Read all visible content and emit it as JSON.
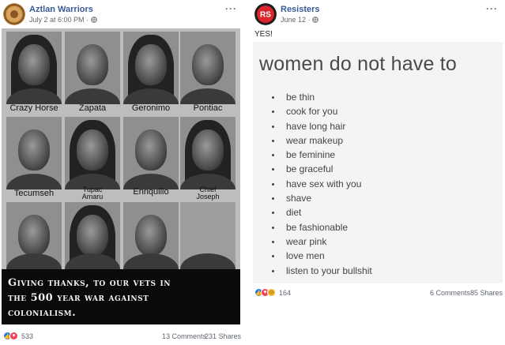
{
  "post_left": {
    "author": "Aztlan Warriors",
    "date": "July 2 at 6:00 PM",
    "separator": "·",
    "privacy_icon": "globe-icon",
    "more_icon": "more-options-icon",
    "more_label": "···",
    "image": {
      "portraits": [
        {
          "name": "Crazy Horse"
        },
        {
          "name": "Zapata"
        },
        {
          "name": "Geronimo"
        },
        {
          "name": "Pontiac"
        },
        {
          "name": "Tecumseh"
        },
        {
          "name_line1": "Tupac",
          "name_line2": "Amaru"
        },
        {
          "name": "Enriquillo"
        },
        {
          "name_line1": "Chief",
          "name_line2": "Joseph"
        },
        {},
        {},
        {},
        {}
      ],
      "caption_line1": "Giving thanks, to our vets in",
      "caption_line2": "the 500 year war against",
      "caption_line3": "colonialism."
    },
    "reactions": [
      "like",
      "love"
    ],
    "reaction_count": "533",
    "comments": "13 Comments",
    "shares": "231 Shares"
  },
  "post_right": {
    "author": "Resisters",
    "avatar_text": "RS",
    "date": "June 12",
    "separator": "·",
    "privacy_icon": "globe-icon",
    "more_icon": "more-options-icon",
    "more_label": "···",
    "text": "YES!",
    "image": {
      "headline": "women do not have to",
      "items": [
        "be thin",
        "cook for you",
        "have long hair",
        "wear makeup",
        "be feminine",
        "be graceful",
        "have sex with you",
        "shave",
        "diet",
        "be fashionable",
        "wear pink",
        "love men",
        "listen to your bullshit"
      ]
    },
    "reactions": [
      "like",
      "love",
      "haha"
    ],
    "reaction_count": "164",
    "comments": "6 Comments",
    "shares": "85 Shares"
  },
  "colors": {
    "link_blue": "#385898",
    "meta_gray": "#606770",
    "like_blue": "#1877f2",
    "love_red": "#f33e58",
    "haha_yellow": "#f7b125",
    "caption_bg": "#0a0a0a",
    "resisters_red": "#d9252b"
  }
}
